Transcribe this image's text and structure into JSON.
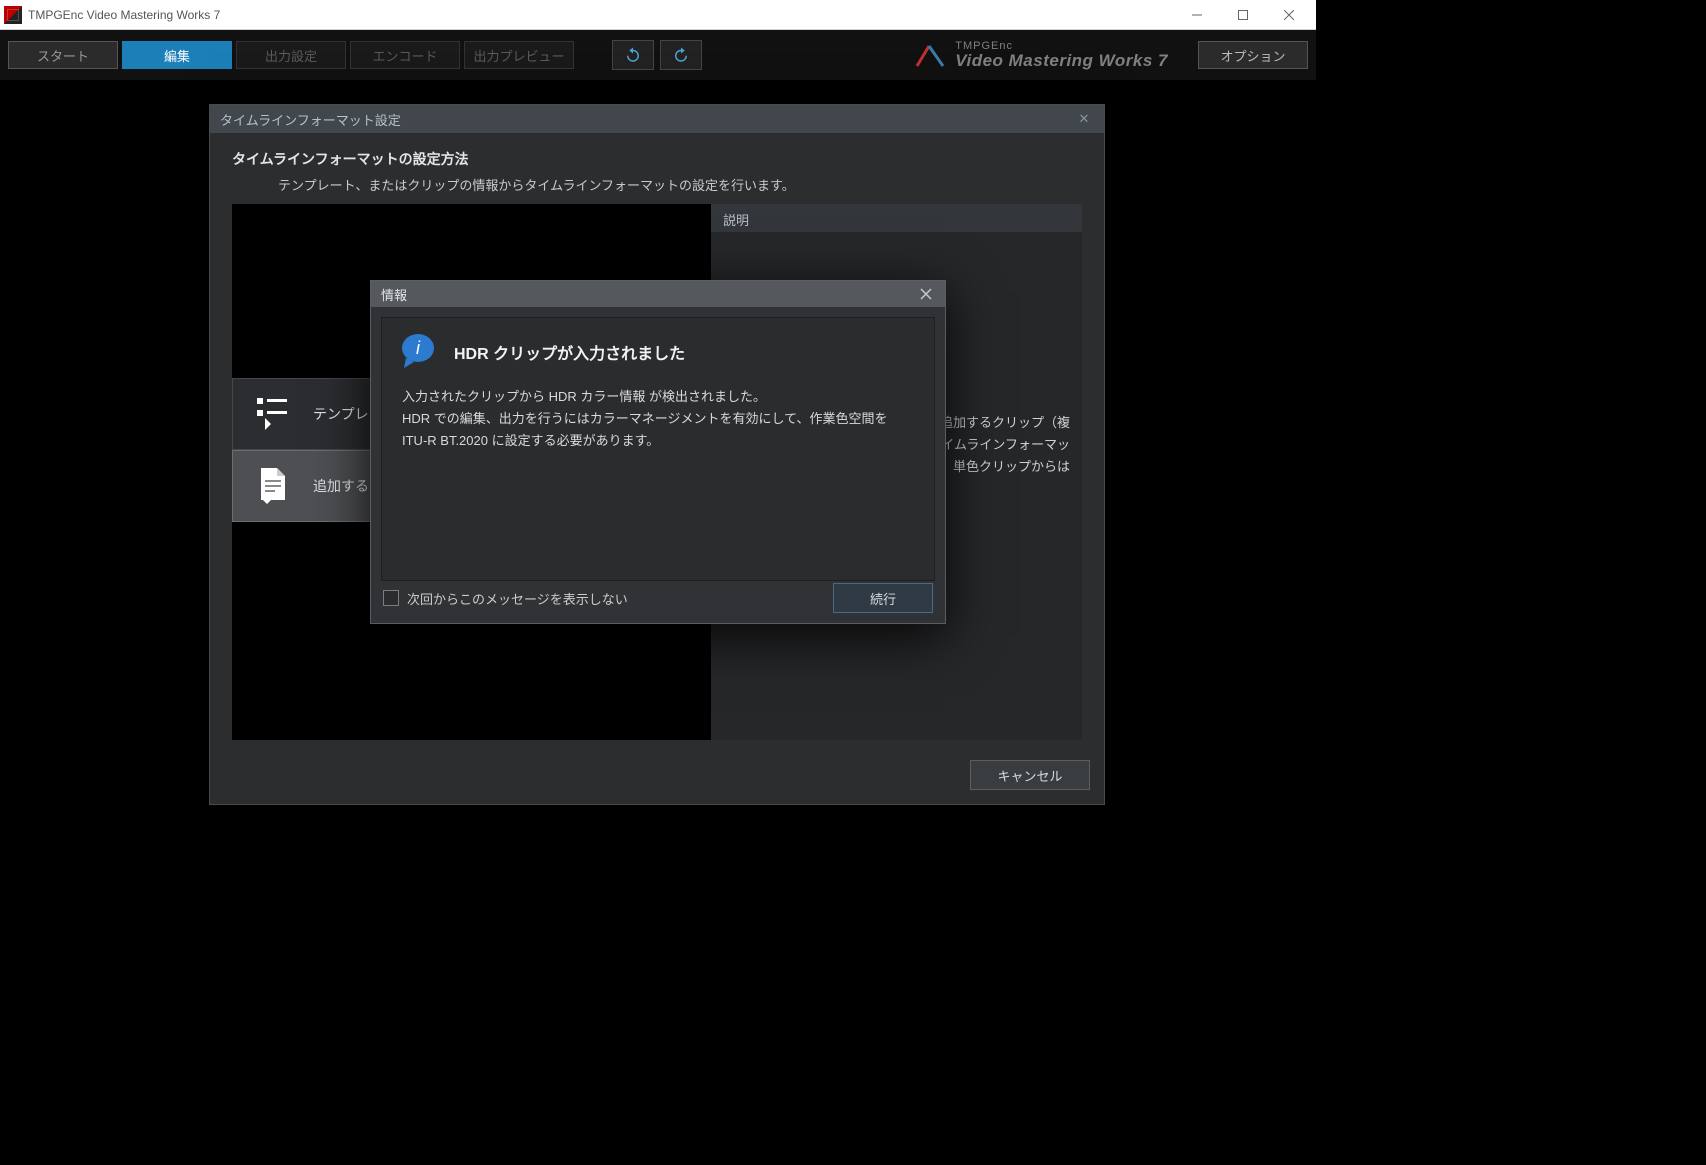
{
  "window": {
    "title": "TMPGEnc Video Mastering Works 7"
  },
  "toolbar": {
    "tabs": {
      "start": "スタート",
      "edit": "編集",
      "output_settings": "出力設定",
      "encode": "エンコード",
      "output_preview": "出力プレビュー"
    },
    "brand_line1": "TMPGEnc",
    "brand_line2": "Video Mastering Works 7",
    "options": "オプション"
  },
  "panel": {
    "title": "タイムラインフォーマット設定",
    "heading": "タイムラインフォーマットの設定方法",
    "subheading": "テンプレート、またはクリップの情報からタイムラインフォーマットの設定を行います。",
    "desc_header": "説明",
    "desc_body_1": "。追加するクリップ（複",
    "desc_body_2": "から、タイムラインフォーマッ",
    "desc_body_3": "ショー、単色クリップからは",
    "option_template": "テンプレー",
    "option_add_clip": "追加する",
    "cancel": "キャンセル"
  },
  "modal": {
    "title": "情報",
    "heading": "HDR クリップが入力されました",
    "msg_line1": "入力されたクリップから HDR カラー情報 が検出されました。",
    "msg_line2": "HDR での編集、出力を行うにはカラーマネージメントを有効にして、作業色空間を",
    "msg_line3": "ITU-R BT.2020 に設定する必要があります。",
    "dont_show": "次回からこのメッセージを表示しない",
    "continue": "続行"
  }
}
